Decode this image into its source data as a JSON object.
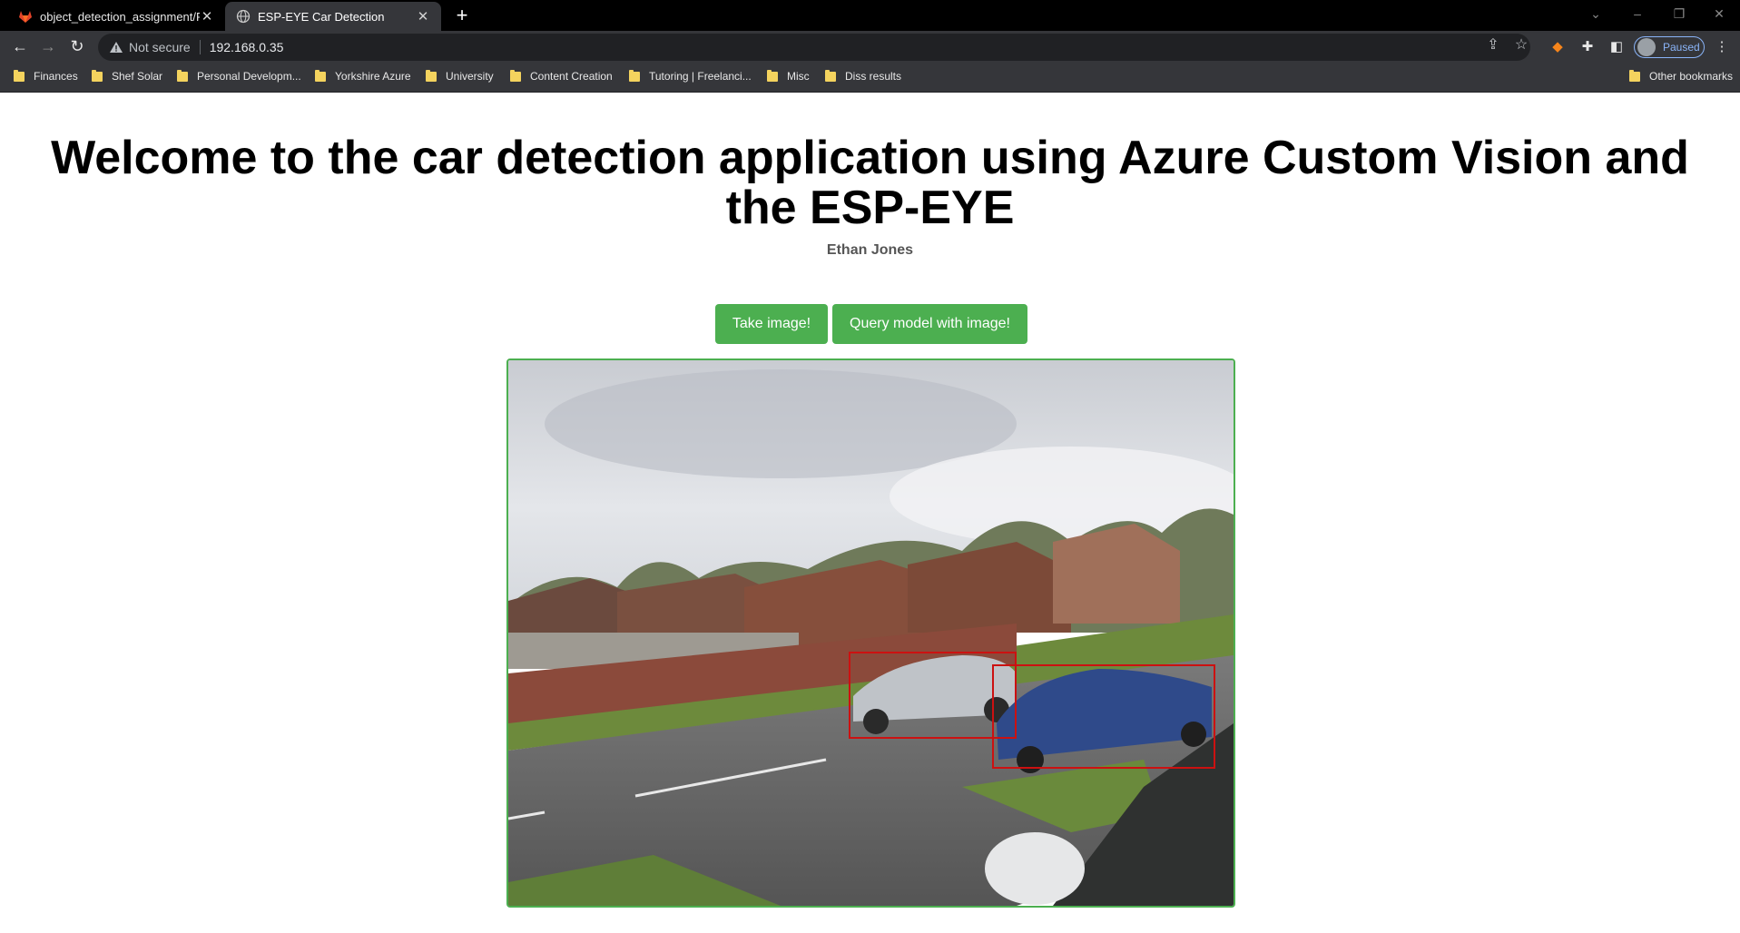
{
  "browser": {
    "tabs": [
      {
        "title": "object_detection_assignment/RE",
        "active": false
      },
      {
        "title": "ESP-EYE Car Detection",
        "active": true
      }
    ],
    "new_tab_label": "+",
    "address": {
      "security_label": "Not secure",
      "url": "192.168.0.35"
    },
    "profile_status": "Paused",
    "bookmarks": [
      "Finances",
      "Shef Solar",
      "Personal Developm...",
      "Yorkshire Azure",
      "University",
      "Content Creation",
      "Tutoring | Freelanci...",
      "Misc",
      "Diss results"
    ],
    "other_bookmarks": "Other bookmarks"
  },
  "page": {
    "heading": "Welcome to the car detection application using Azure Custom Vision and the ESP-EYE",
    "author": "Ethan Jones",
    "buttons": {
      "take_image": "Take image!",
      "query_model": "Query model with image!"
    },
    "detections_count": 2
  },
  "colors": {
    "button_green": "#4caf50",
    "detection_box": "#cc1111",
    "chrome_dark": "#35363a"
  }
}
